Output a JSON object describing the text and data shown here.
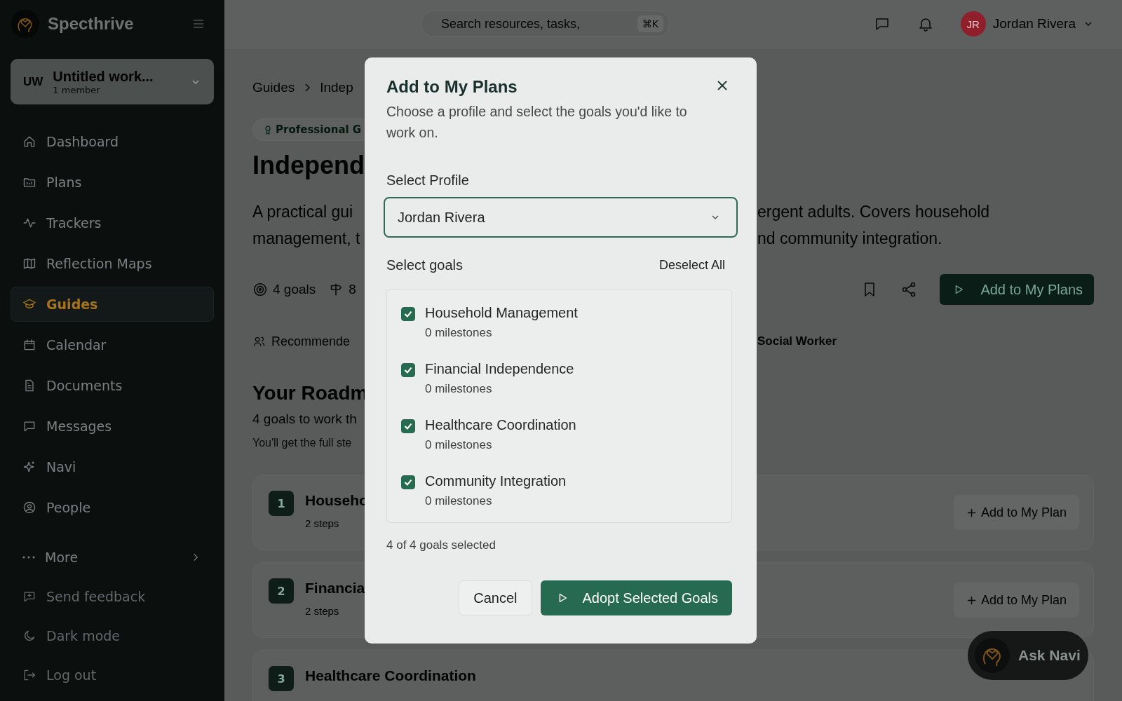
{
  "sidebar": {
    "brand": "Specthrive",
    "workspace": {
      "initials": "UW",
      "name": "Untitled work...",
      "members": "1 member"
    },
    "nav": [
      {
        "label": "Dashboard",
        "selected": false
      },
      {
        "label": "Plans",
        "selected": false
      },
      {
        "label": "Trackers",
        "selected": false
      },
      {
        "label": "Reflection Maps",
        "selected": false
      },
      {
        "label": "Guides",
        "selected": true
      },
      {
        "label": "Calendar",
        "selected": false
      },
      {
        "label": "Documents",
        "selected": false
      },
      {
        "label": "Messages",
        "selected": false
      },
      {
        "label": "Navi",
        "selected": false
      },
      {
        "label": "People",
        "selected": false
      }
    ],
    "more": "More",
    "footer": [
      "Send feedback",
      "Dark mode",
      "Log out"
    ]
  },
  "header": {
    "search": {
      "placeholder": "Search resources, tasks,",
      "shortcut": "⌘K"
    },
    "user": {
      "initials": "JR",
      "name": "Jordan Rivera"
    }
  },
  "page": {
    "breadcrumb": [
      "Guides",
      "Indep"
    ],
    "badge": "Professional G",
    "title": "Independ",
    "description": [
      {
        "left": "A practical gui",
        "right": "ergent adults. Covers household"
      },
      {
        "left": "management, t",
        "right": "nd community integration."
      }
    ],
    "stats": [
      "4 goals",
      "8"
    ],
    "primary_button": "Add to My Plans",
    "recommended": {
      "left": "Recommende",
      "right": "Social Worker"
    },
    "roadmap": {
      "title": "Your Roadm",
      "subtitle": "4 goals to work th",
      "note": "You'll get the full ste"
    },
    "goals": [
      {
        "number": "1",
        "title": "Househo",
        "steps": "2 steps",
        "button": "Add to My Plan"
      },
      {
        "number": "2",
        "title": "Financia",
        "steps": "2 steps",
        "button": "Add to My Plan"
      },
      {
        "number": "3",
        "title": "Healthcare Coordination"
      }
    ]
  },
  "dialog": {
    "title": "Add to My Plans",
    "subtitle": "Choose a profile and select the goals you'd like to work on.",
    "profile_label": "Select Profile",
    "profile_value": "Jordan Rivera",
    "goals_label": "Select goals",
    "deselect": "Deselect All",
    "goals": [
      {
        "title": "Household Management",
        "milestones": "0 milestones",
        "checked": true
      },
      {
        "title": "Financial Independence",
        "milestones": "0 milestones",
        "checked": true
      },
      {
        "title": "Healthcare Coordination",
        "milestones": "0 milestones",
        "checked": true
      },
      {
        "title": "Community Integration",
        "milestones": "0 milestones",
        "checked": true
      }
    ],
    "summary": "4 of 4 goals selected",
    "cancel": "Cancel",
    "confirm": "Adopt Selected Goals"
  },
  "ask_navi": "Ask Navi"
}
